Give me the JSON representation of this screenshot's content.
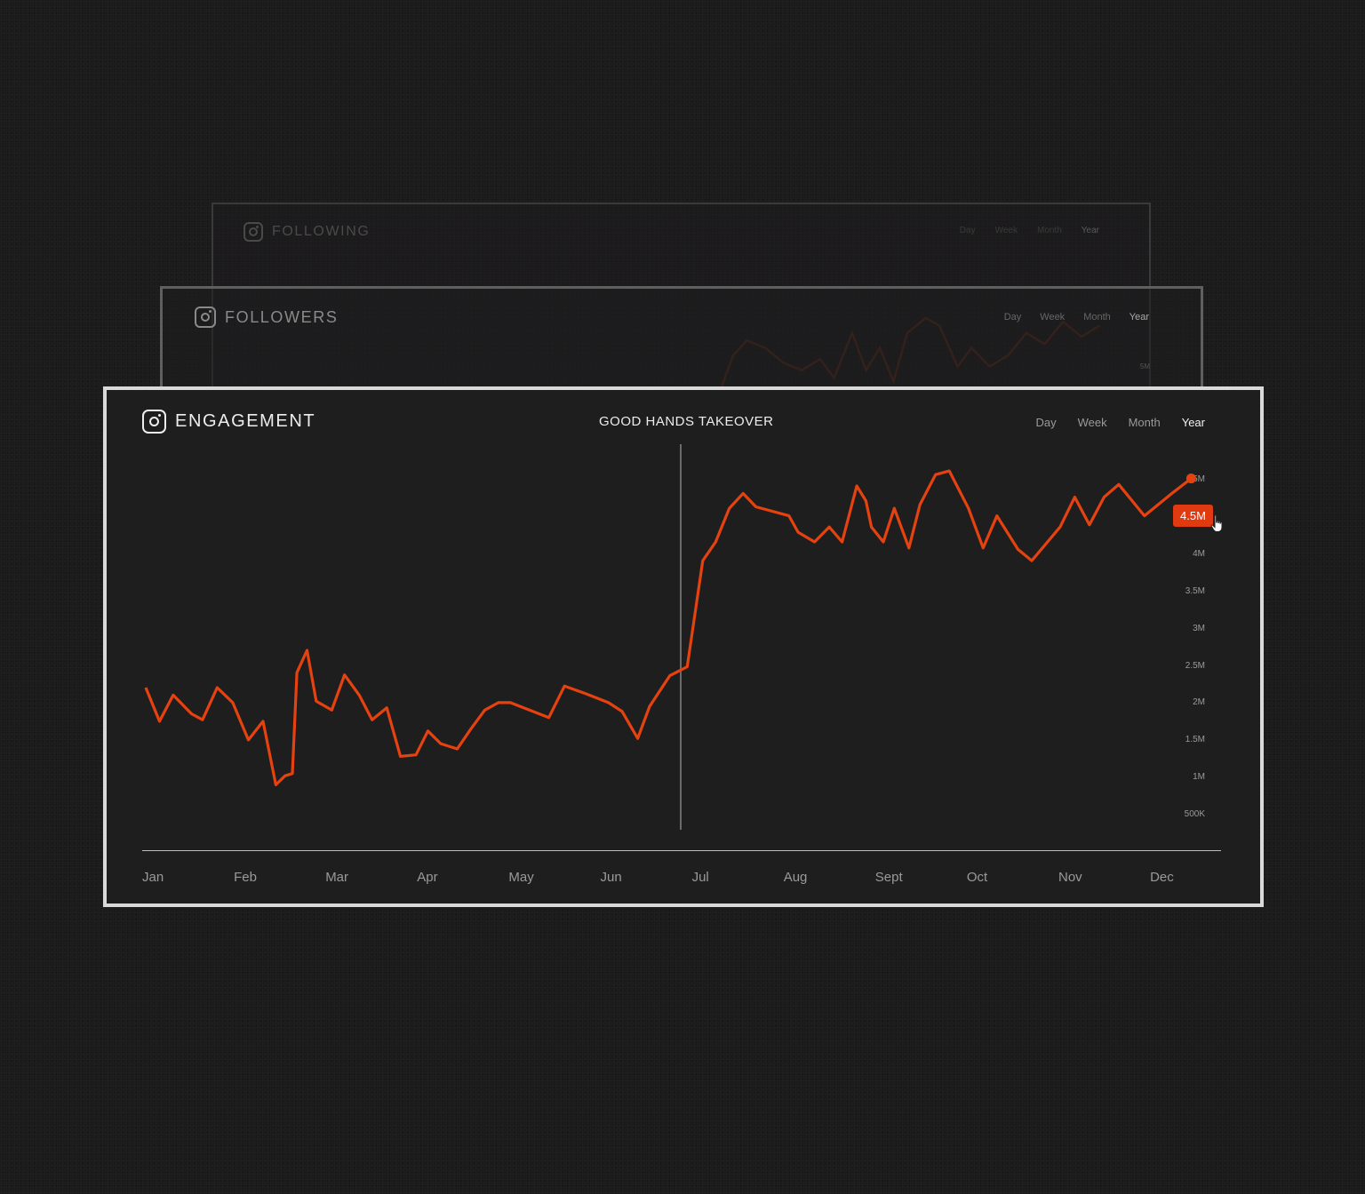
{
  "cards": {
    "following": {
      "title": "FOLLOWING",
      "tabs": [
        "Day",
        "Week",
        "Month",
        "Year"
      ],
      "active_tab": "Year"
    },
    "followers": {
      "title": "FOLLOWERS",
      "tabs": [
        "Day",
        "Week",
        "Month",
        "Year"
      ],
      "active_tab": "Year",
      "ytick": "5M"
    },
    "engagement": {
      "title": "ENGAGEMENT",
      "annotation": "GOOD HANDS TAKEOVER",
      "tabs": [
        "Day",
        "Week",
        "Month",
        "Year"
      ],
      "active_tab": "Year",
      "tooltip": "4.5M"
    }
  },
  "colors": {
    "accent": "#e6420f",
    "background": "#1c1b1b",
    "card": "#1e1e1f",
    "text_active": "#f0f0f0",
    "text_muted": "#9a9a9a"
  },
  "icons": {
    "card_icon": "instagram-icon",
    "pointer": "hand-cursor-icon"
  },
  "chart_data": {
    "type": "line",
    "title": "ENGAGEMENT",
    "categories": [
      "Jan",
      "Feb",
      "Mar",
      "Apr",
      "May",
      "Jun",
      "Jul",
      "Aug",
      "Sept",
      "Oct",
      "Nov",
      "Dec"
    ],
    "yticks": [
      "5M",
      "4.5M",
      "4M",
      "3.5M",
      "3M",
      "2.5M",
      "2M",
      "1.5M",
      "1M",
      "500K"
    ],
    "ylim": [
      500000,
      5000000
    ],
    "grid": false,
    "annotation": {
      "label": "GOOD HANDS TAKEOVER",
      "x": 5.94
    },
    "series": [
      {
        "values": [
          [
            0.0,
            1.7
          ],
          [
            0.15,
            1.25
          ],
          [
            0.3,
            1.6
          ],
          [
            0.5,
            1.35
          ],
          [
            0.62,
            1.27
          ],
          [
            0.78,
            1.7
          ],
          [
            0.95,
            1.5
          ],
          [
            1.12,
            1.0
          ],
          [
            1.28,
            1.25
          ],
          [
            1.42,
            0.4
          ],
          [
            1.52,
            0.52
          ],
          [
            1.6,
            0.55
          ],
          [
            1.65,
            1.9
          ],
          [
            1.76,
            2.2
          ],
          [
            1.86,
            1.52
          ],
          [
            2.03,
            1.4
          ],
          [
            2.17,
            1.87
          ],
          [
            2.33,
            1.6
          ],
          [
            2.47,
            1.27
          ],
          [
            2.63,
            1.43
          ],
          [
            2.78,
            0.78
          ],
          [
            2.95,
            0.8
          ],
          [
            3.08,
            1.12
          ],
          [
            3.22,
            0.95
          ],
          [
            3.4,
            0.88
          ],
          [
            3.55,
            1.15
          ],
          [
            3.7,
            1.4
          ],
          [
            3.85,
            1.5
          ],
          [
            3.98,
            1.5
          ],
          [
            4.4,
            1.3
          ],
          [
            4.57,
            1.72
          ],
          [
            4.8,
            1.62
          ],
          [
            5.05,
            1.5
          ],
          [
            5.2,
            1.38
          ],
          [
            5.37,
            1.02
          ],
          [
            5.5,
            1.45
          ],
          [
            5.72,
            1.86
          ],
          [
            5.91,
            1.98
          ],
          [
            6.08,
            3.4
          ],
          [
            6.22,
            3.65
          ],
          [
            6.37,
            4.1
          ],
          [
            6.52,
            4.3
          ],
          [
            6.66,
            4.12
          ],
          [
            7.02,
            4.0
          ],
          [
            7.12,
            3.78
          ],
          [
            7.3,
            3.65
          ],
          [
            7.46,
            3.85
          ],
          [
            7.6,
            3.65
          ],
          [
            7.76,
            4.4
          ],
          [
            7.86,
            4.2
          ],
          [
            7.92,
            3.85
          ],
          [
            8.05,
            3.65
          ],
          [
            8.17,
            4.1
          ],
          [
            8.33,
            3.57
          ],
          [
            8.45,
            4.15
          ],
          [
            8.62,
            4.55
          ],
          [
            8.77,
            4.6
          ],
          [
            8.98,
            4.1
          ],
          [
            9.14,
            3.57
          ],
          [
            9.29,
            4.0
          ],
          [
            9.52,
            3.55
          ],
          [
            9.67,
            3.4
          ],
          [
            9.98,
            3.85
          ],
          [
            10.14,
            4.25
          ],
          [
            10.3,
            3.88
          ],
          [
            10.46,
            4.25
          ],
          [
            10.62,
            4.42
          ],
          [
            10.9,
            4.0
          ],
          [
            11.2,
            4.3
          ],
          [
            11.41,
            4.5
          ]
        ]
      }
    ],
    "ghost_series": [
      [
        [
          0.6,
          3.4
        ],
        [
          0.7,
          3.1
        ],
        [
          0.85,
          3.4
        ],
        [
          1.0,
          3.2
        ],
        [
          1.2,
          3.1
        ],
        [
          1.35,
          3.5
        ],
        [
          1.5,
          3.3
        ],
        [
          1.7,
          3.0
        ],
        [
          1.82,
          3.05
        ],
        [
          1.93,
          2.3
        ],
        [
          2.0,
          2.45
        ],
        [
          2.08,
          3.8
        ],
        [
          2.18,
          4.1
        ],
        [
          2.3,
          3.3
        ],
        [
          2.45,
          3.25
        ],
        [
          2.6,
          3.6
        ],
        [
          2.75,
          3.4
        ],
        [
          2.9,
          3.2
        ],
        [
          3.05,
          3.1
        ],
        [
          3.2,
          2.6
        ],
        [
          3.35,
          2.6
        ],
        [
          3.5,
          2.95
        ],
        [
          3.65,
          2.75
        ],
        [
          3.85,
          2.8
        ],
        [
          4.0,
          3.1
        ],
        [
          4.2,
          3.3
        ],
        [
          4.4,
          3.35
        ],
        [
          4.7,
          3.2
        ],
        [
          4.85,
          3.5
        ],
        [
          5.05,
          3.45
        ],
        [
          5.3,
          3.3
        ],
        [
          5.5,
          3.0
        ],
        [
          5.75,
          3.6
        ],
        [
          5.9,
          3.9
        ]
      ],
      [
        [
          6.1,
          5.2
        ],
        [
          6.3,
          5.6
        ],
        [
          6.45,
          6.1
        ],
        [
          6.6,
          6.3
        ],
        [
          6.8,
          6.2
        ],
        [
          7.0,
          6.0
        ],
        [
          7.2,
          5.9
        ],
        [
          7.4,
          6.05
        ],
        [
          7.55,
          5.8
        ],
        [
          7.75,
          6.4
        ],
        [
          7.9,
          5.9
        ],
        [
          8.05,
          6.2
        ],
        [
          8.2,
          5.75
        ],
        [
          8.35,
          6.4
        ],
        [
          8.55,
          6.6
        ],
        [
          8.7,
          6.5
        ],
        [
          8.9,
          5.95
        ],
        [
          9.05,
          6.2
        ],
        [
          9.25,
          5.95
        ],
        [
          9.45,
          6.1
        ],
        [
          9.65,
          6.4
        ],
        [
          9.85,
          6.25
        ],
        [
          10.05,
          6.55
        ],
        [
          10.25,
          6.35
        ],
        [
          10.45,
          6.5
        ]
      ],
      [
        [
          6.3,
          4.9
        ],
        [
          6.5,
          5.4
        ],
        [
          6.7,
          5.2
        ],
        [
          6.9,
          5.1
        ],
        [
          7.1,
          5.3
        ],
        [
          7.3,
          5.05
        ],
        [
          7.5,
          5.25
        ],
        [
          7.7,
          4.95
        ],
        [
          7.9,
          5.45
        ],
        [
          8.1,
          5.0
        ],
        [
          8.3,
          5.3
        ],
        [
          8.5,
          5.05
        ],
        [
          8.7,
          5.5
        ],
        [
          8.9,
          5.1
        ],
        [
          9.1,
          4.95
        ],
        [
          9.3,
          5.25
        ],
        [
          9.5,
          5.05
        ],
        [
          9.7,
          5.35
        ],
        [
          9.9,
          5.15
        ],
        [
          10.1,
          5.4
        ],
        [
          10.3,
          5.2
        ],
        [
          10.5,
          5.35
        ]
      ]
    ]
  }
}
